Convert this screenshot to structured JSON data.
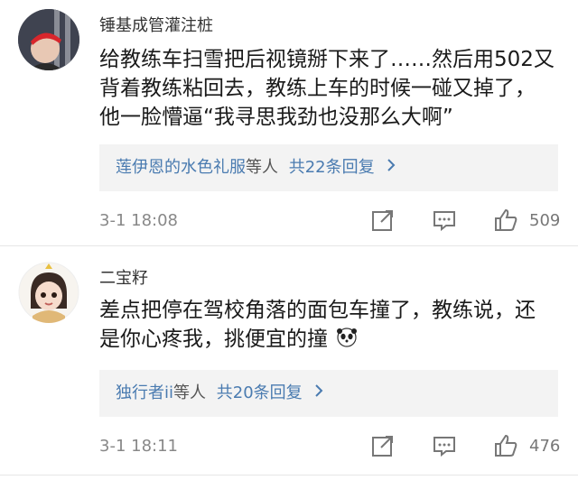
{
  "comments": [
    {
      "username": "锤基成管灌注桩",
      "text_lines": [
        "给教练车扫雪把后视镜掰下来了……然后用502又",
        "背着教练粘回去，教练上车的时候一碰又掉了，",
        "他一脸懵逼“我寻思我劲也没那么大啊”"
      ],
      "replies_by": "莲伊恩的水色礼服",
      "replies_suffix": "等人",
      "replies_count": "共22条回复",
      "time": "3-1 18:08",
      "likes": "509"
    },
    {
      "username": "二宝籽",
      "text_lines": [
        "差点把停在驾校角落的面包车撞了，教练说，还",
        "是你心疼我，挑便宜的撞"
      ],
      "replies_by": "独行者ii",
      "replies_suffix": "等人",
      "replies_count": "共20条回复",
      "time": "3-1 18:11",
      "likes": "476"
    }
  ],
  "colors": {
    "link": "#4a7bb0",
    "reply_bg": "#f3f3f3",
    "meta": "#888888"
  }
}
